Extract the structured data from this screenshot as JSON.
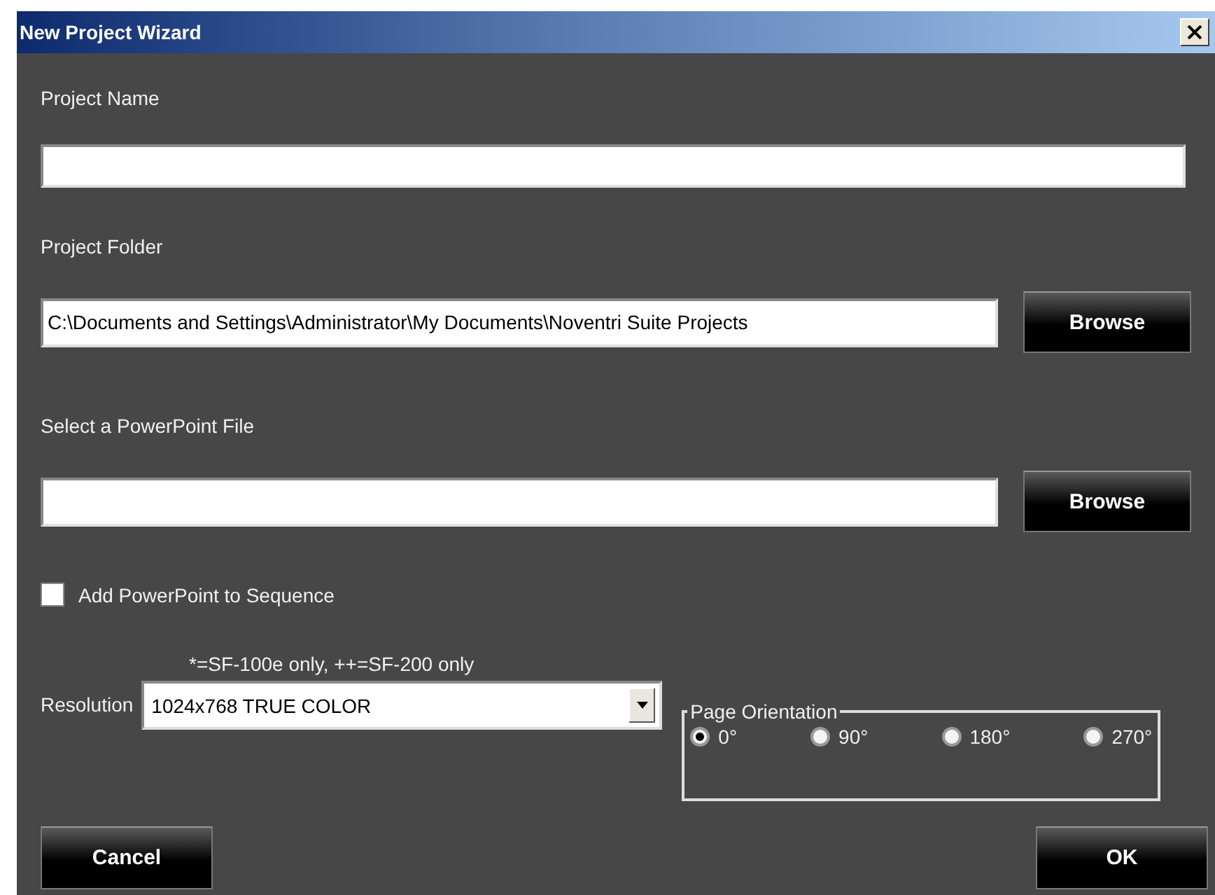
{
  "window": {
    "title": "New Project Wizard"
  },
  "fields": [
    {
      "label": "Project Name"
    },
    {
      "label": "Project Folder",
      "value": "C:\\Documents and Settings\\Administrator\\My Documents\\Noventri Suite Projects",
      "button": "Browse"
    },
    {
      "label": "Select a PowerPoint File",
      "button": "Browse"
    }
  ],
  "add_to_sequence": {
    "label": "Add PowerPoint to Sequence",
    "checked": false
  },
  "note": "*=SF-100e only, ++=SF-200 only",
  "resolution": {
    "label": "Resolution",
    "value": "1024x768 TRUE COLOR"
  },
  "page_orientation": {
    "title": "Page Orientation",
    "options": [
      {
        "label": "0°",
        "selected": true
      },
      {
        "label": "90°",
        "selected": false
      },
      {
        "label": "180°",
        "selected": false
      },
      {
        "label": "270°",
        "selected": false
      }
    ]
  },
  "buttons": {
    "cancel": "Cancel",
    "ok": "OK"
  }
}
